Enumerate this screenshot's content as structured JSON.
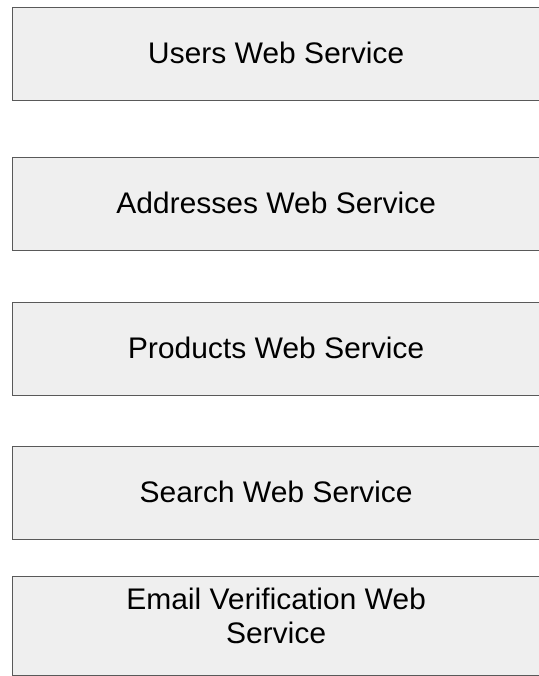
{
  "services": [
    {
      "label": "Users Web Service"
    },
    {
      "label": "Addresses Web Service"
    },
    {
      "label": "Products Web Service"
    },
    {
      "label": "Search Web Service"
    },
    {
      "label": "Email Verification Web Service"
    }
  ],
  "colors": {
    "box_fill": "#efefef",
    "box_border": "#595959",
    "text": "#000000"
  }
}
